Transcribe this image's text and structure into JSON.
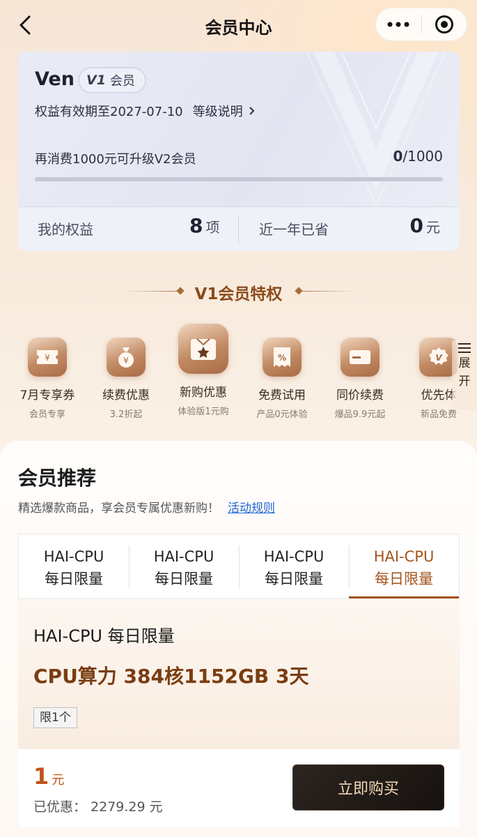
{
  "nav": {
    "title": "会员中心"
  },
  "member": {
    "name": "Ven",
    "level_code": "V1",
    "level_text": "会员",
    "validity": "权益有效期至2027-07-10",
    "level_explain": "等级说明",
    "upgrade_hint": "再消费1000元可升级V2会员",
    "progress_current": "0",
    "progress_total": "/1000",
    "progress_fraction": 0,
    "benefits_label": "我的权益",
    "benefits_count": "8",
    "benefits_unit": "项",
    "saved_label": "近一年已省",
    "saved_amount": "0",
    "saved_unit": "元"
  },
  "privileges": {
    "title": "V1会员特权",
    "items": [
      {
        "name": "7月专享券",
        "sub": "会员专享",
        "icon": "coupon-icon"
      },
      {
        "name": "续费优惠",
        "sub": "3.2折起",
        "icon": "money-bag-icon"
      },
      {
        "name": "新购优惠",
        "sub": "体验版1元购",
        "icon": "gift-star-icon"
      },
      {
        "name": "免费试用",
        "sub": "产品0元体验",
        "icon": "percent-ticket-icon"
      },
      {
        "name": "同价续费",
        "sub": "爆品9.9元起",
        "icon": "card-icon"
      },
      {
        "name": "优先体",
        "sub": "新品免费",
        "icon": "v-badge-icon"
      }
    ],
    "expand_label_1": "展",
    "expand_label_2": "开"
  },
  "recommend": {
    "title": "会员推荐",
    "subtitle": "精选爆款商品，享会员专属优惠新购！",
    "rules_link": "活动规则",
    "tabs": [
      {
        "line1": "HAI-CPU",
        "line2": "每日限量"
      },
      {
        "line1": "HAI-CPU",
        "line2": "每日限量"
      },
      {
        "line1": "HAI-CPU",
        "line2": "每日限量"
      },
      {
        "line1": "HAI-CPU",
        "line2": "每日限量"
      }
    ],
    "active_tab": 3,
    "product": {
      "name": "HAI-CPU 每日限量",
      "spec": "CPU算力 384核1152GB 3天",
      "limit_tag": "限1个",
      "price": "1",
      "price_unit": "元",
      "saved": "已优惠：  2279.29 元",
      "buy_label": "立即购买"
    }
  },
  "colors": {
    "accent": "#a4531f",
    "brand_brown": "#8c4b1a",
    "link": "#1f64d3",
    "price": "#c0541c"
  }
}
